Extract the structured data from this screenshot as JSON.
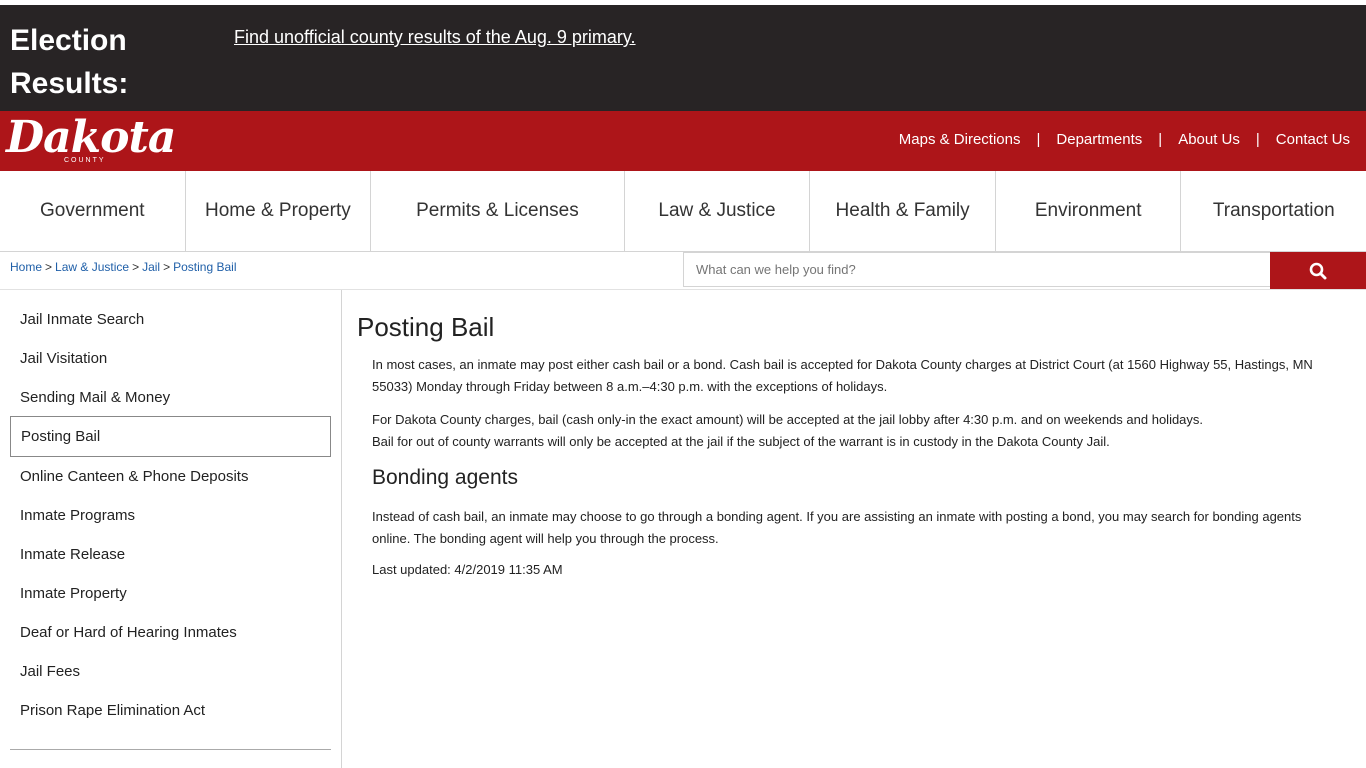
{
  "alert": {
    "title": "Election Results:",
    "link": "Find unofficial county results of the Aug. 9 primary."
  },
  "brand": {
    "logo_text": "Dakota",
    "logo_sub": "COUNTY",
    "primary_color": "#ad1519",
    "alert_bg": "#282425"
  },
  "utility_nav": {
    "items": [
      "Maps & Directions",
      "Departments",
      "About Us",
      "Contact Us"
    ],
    "separator": "|"
  },
  "main_nav": {
    "items": [
      "Government",
      "Home & Property",
      "Permits & Licenses",
      "Law & Justice",
      "Health & Family",
      "Environment",
      "Transportation"
    ]
  },
  "breadcrumb": {
    "items": [
      "Home",
      "Law & Justice",
      "Jail",
      "Posting Bail"
    ],
    "separator": ">"
  },
  "search": {
    "placeholder": "What can we help you find?",
    "icon": "search-icon"
  },
  "sidebar": {
    "items": [
      "Jail Inmate Search",
      "Jail Visitation",
      "Sending Mail & Money",
      "Posting Bail",
      "Online Canteen & Phone Deposits",
      "Inmate Programs",
      "Inmate Release",
      "Inmate Property",
      "Deaf or Hard of Hearing Inmates",
      "Jail Fees",
      "Prison Rape Elimination Act"
    ],
    "active": "Posting Bail"
  },
  "content": {
    "title": "Posting Bail",
    "p1": "In most cases, an inmate may post either cash bail or a bond. Cash bail is accepted for Dakota County charges at District Court (at 1560 Highway 55, Hastings, MN 55033) Monday through Friday between 8 a.m.–4:30 p.m. with the exceptions of holidays.",
    "p2a": "For Dakota County charges, bail (cash only-in the exact amount) will be accepted at the jail lobby after 4:30 p.m. and on weekends and holidays.",
    "p2b": "Bail for out of county warrants will only be accepted at the jail if the subject of the warrant is in custody in the Dakota County Jail.",
    "subheading": "Bonding agents",
    "p3": "Instead of cash bail, an inmate may choose to go through a bonding agent. If you are assisting an inmate with posting a bond, you may search for bonding agents online. The bonding agent will help you through the process.",
    "updated": "Last updated: 4/2/2019 11:35 AM"
  }
}
